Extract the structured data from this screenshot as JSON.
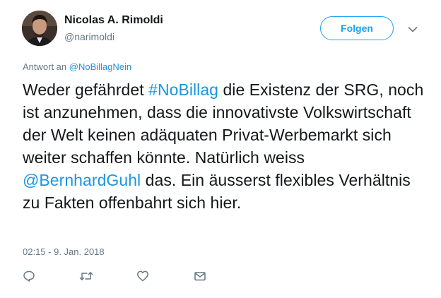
{
  "user": {
    "name": "Nicolas A. Rimoldi",
    "handle": "@narimoldi",
    "avatar_icon": "profile-photo"
  },
  "follow": {
    "label": "Folgen",
    "color": "#1da1f2"
  },
  "reply_context": {
    "prefix": "Antwort an",
    "mention": "@NoBillagNein"
  },
  "tweet": {
    "segments": [
      {
        "text": "Weder gefährdet ",
        "link": false
      },
      {
        "text": "#NoBillag",
        "link": true
      },
      {
        "text": " die Existenz der SRG, noch ist anzunehmen, dass die innovativste Volkswirtschaft der Welt keinen adäquaten Privat-Werbemarkt sich weiter schaffen könnte. Natürlich weiss ",
        "link": false
      },
      {
        "text": "@BernhardGuhl",
        "link": true
      },
      {
        "text": " das. Ein äusserst flexibles Verhältnis zu Fakten offenbahrt sich hier.",
        "link": false
      }
    ],
    "link_color": "#1b95e0"
  },
  "timestamp": "02:15 - 9. Jan. 2018",
  "actions": [
    {
      "name": "reply",
      "icon": "reply-icon"
    },
    {
      "name": "retweet",
      "icon": "retweet-icon"
    },
    {
      "name": "like",
      "icon": "heart-icon"
    },
    {
      "name": "message",
      "icon": "envelope-icon"
    }
  ]
}
